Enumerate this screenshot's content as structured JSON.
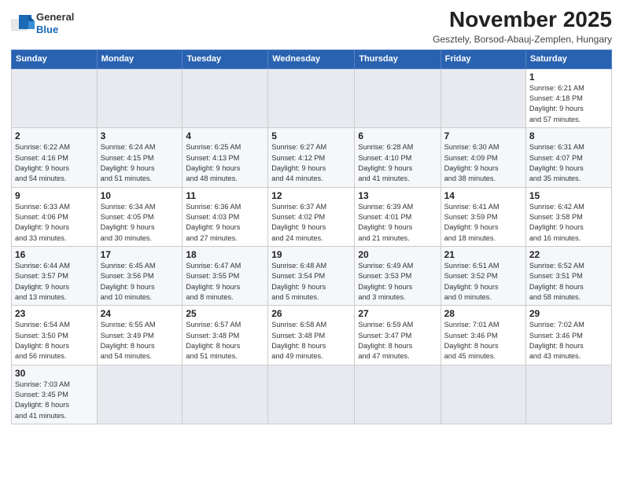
{
  "header": {
    "logo_text_general": "General",
    "logo_text_blue": "Blue",
    "month_title": "November 2025",
    "subtitle": "Gesztely, Borsod-Abauj-Zemplen, Hungary"
  },
  "weekdays": [
    "Sunday",
    "Monday",
    "Tuesday",
    "Wednesday",
    "Thursday",
    "Friday",
    "Saturday"
  ],
  "weeks": [
    {
      "days": [
        {
          "num": "",
          "info": "",
          "empty": true
        },
        {
          "num": "",
          "info": "",
          "empty": true
        },
        {
          "num": "",
          "info": "",
          "empty": true
        },
        {
          "num": "",
          "info": "",
          "empty": true
        },
        {
          "num": "",
          "info": "",
          "empty": true
        },
        {
          "num": "",
          "info": "",
          "empty": true
        },
        {
          "num": "1",
          "info": "Sunrise: 6:21 AM\nSunset: 4:18 PM\nDaylight: 9 hours\nand 57 minutes.",
          "empty": false
        }
      ]
    },
    {
      "days": [
        {
          "num": "2",
          "info": "Sunrise: 6:22 AM\nSunset: 4:16 PM\nDaylight: 9 hours\nand 54 minutes.",
          "empty": false
        },
        {
          "num": "3",
          "info": "Sunrise: 6:24 AM\nSunset: 4:15 PM\nDaylight: 9 hours\nand 51 minutes.",
          "empty": false
        },
        {
          "num": "4",
          "info": "Sunrise: 6:25 AM\nSunset: 4:13 PM\nDaylight: 9 hours\nand 48 minutes.",
          "empty": false
        },
        {
          "num": "5",
          "info": "Sunrise: 6:27 AM\nSunset: 4:12 PM\nDaylight: 9 hours\nand 44 minutes.",
          "empty": false
        },
        {
          "num": "6",
          "info": "Sunrise: 6:28 AM\nSunset: 4:10 PM\nDaylight: 9 hours\nand 41 minutes.",
          "empty": false
        },
        {
          "num": "7",
          "info": "Sunrise: 6:30 AM\nSunset: 4:09 PM\nDaylight: 9 hours\nand 38 minutes.",
          "empty": false
        },
        {
          "num": "8",
          "info": "Sunrise: 6:31 AM\nSunset: 4:07 PM\nDaylight: 9 hours\nand 35 minutes.",
          "empty": false
        }
      ]
    },
    {
      "days": [
        {
          "num": "9",
          "info": "Sunrise: 6:33 AM\nSunset: 4:06 PM\nDaylight: 9 hours\nand 33 minutes.",
          "empty": false
        },
        {
          "num": "10",
          "info": "Sunrise: 6:34 AM\nSunset: 4:05 PM\nDaylight: 9 hours\nand 30 minutes.",
          "empty": false
        },
        {
          "num": "11",
          "info": "Sunrise: 6:36 AM\nSunset: 4:03 PM\nDaylight: 9 hours\nand 27 minutes.",
          "empty": false
        },
        {
          "num": "12",
          "info": "Sunrise: 6:37 AM\nSunset: 4:02 PM\nDaylight: 9 hours\nand 24 minutes.",
          "empty": false
        },
        {
          "num": "13",
          "info": "Sunrise: 6:39 AM\nSunset: 4:01 PM\nDaylight: 9 hours\nand 21 minutes.",
          "empty": false
        },
        {
          "num": "14",
          "info": "Sunrise: 6:41 AM\nSunset: 3:59 PM\nDaylight: 9 hours\nand 18 minutes.",
          "empty": false
        },
        {
          "num": "15",
          "info": "Sunrise: 6:42 AM\nSunset: 3:58 PM\nDaylight: 9 hours\nand 16 minutes.",
          "empty": false
        }
      ]
    },
    {
      "days": [
        {
          "num": "16",
          "info": "Sunrise: 6:44 AM\nSunset: 3:57 PM\nDaylight: 9 hours\nand 13 minutes.",
          "empty": false
        },
        {
          "num": "17",
          "info": "Sunrise: 6:45 AM\nSunset: 3:56 PM\nDaylight: 9 hours\nand 10 minutes.",
          "empty": false
        },
        {
          "num": "18",
          "info": "Sunrise: 6:47 AM\nSunset: 3:55 PM\nDaylight: 9 hours\nand 8 minutes.",
          "empty": false
        },
        {
          "num": "19",
          "info": "Sunrise: 6:48 AM\nSunset: 3:54 PM\nDaylight: 9 hours\nand 5 minutes.",
          "empty": false
        },
        {
          "num": "20",
          "info": "Sunrise: 6:49 AM\nSunset: 3:53 PM\nDaylight: 9 hours\nand 3 minutes.",
          "empty": false
        },
        {
          "num": "21",
          "info": "Sunrise: 6:51 AM\nSunset: 3:52 PM\nDaylight: 9 hours\nand 0 minutes.",
          "empty": false
        },
        {
          "num": "22",
          "info": "Sunrise: 6:52 AM\nSunset: 3:51 PM\nDaylight: 8 hours\nand 58 minutes.",
          "empty": false
        }
      ]
    },
    {
      "days": [
        {
          "num": "23",
          "info": "Sunrise: 6:54 AM\nSunset: 3:50 PM\nDaylight: 8 hours\nand 56 minutes.",
          "empty": false
        },
        {
          "num": "24",
          "info": "Sunrise: 6:55 AM\nSunset: 3:49 PM\nDaylight: 8 hours\nand 54 minutes.",
          "empty": false
        },
        {
          "num": "25",
          "info": "Sunrise: 6:57 AM\nSunset: 3:48 PM\nDaylight: 8 hours\nand 51 minutes.",
          "empty": false
        },
        {
          "num": "26",
          "info": "Sunrise: 6:58 AM\nSunset: 3:48 PM\nDaylight: 8 hours\nand 49 minutes.",
          "empty": false
        },
        {
          "num": "27",
          "info": "Sunrise: 6:59 AM\nSunset: 3:47 PM\nDaylight: 8 hours\nand 47 minutes.",
          "empty": false
        },
        {
          "num": "28",
          "info": "Sunrise: 7:01 AM\nSunset: 3:46 PM\nDaylight: 8 hours\nand 45 minutes.",
          "empty": false
        },
        {
          "num": "29",
          "info": "Sunrise: 7:02 AM\nSunset: 3:46 PM\nDaylight: 8 hours\nand 43 minutes.",
          "empty": false
        }
      ]
    },
    {
      "days": [
        {
          "num": "30",
          "info": "Sunrise: 7:03 AM\nSunset: 3:45 PM\nDaylight: 8 hours\nand 41 minutes.",
          "empty": false
        },
        {
          "num": "",
          "info": "",
          "empty": true
        },
        {
          "num": "",
          "info": "",
          "empty": true
        },
        {
          "num": "",
          "info": "",
          "empty": true
        },
        {
          "num": "",
          "info": "",
          "empty": true
        },
        {
          "num": "",
          "info": "",
          "empty": true
        },
        {
          "num": "",
          "info": "",
          "empty": true
        }
      ]
    }
  ]
}
